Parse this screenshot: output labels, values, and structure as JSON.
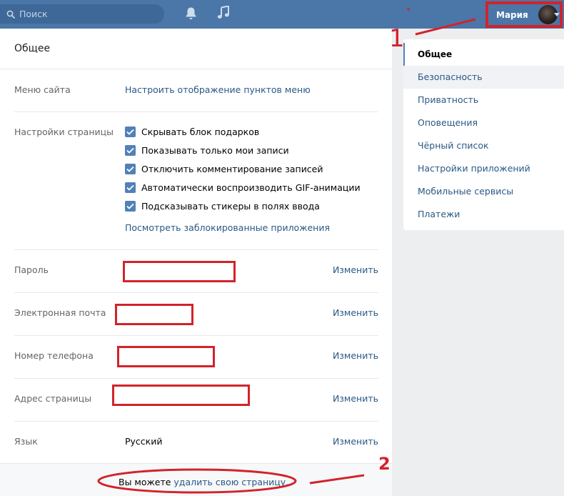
{
  "topbar": {
    "search_placeholder": "Поиск",
    "profile_name": "Мария"
  },
  "main": {
    "title": "Общее",
    "menu_label": "Меню сайта",
    "menu_link": "Настроить отображение пунктов меню",
    "page_settings_label": "Настройки страницы",
    "checkboxes": [
      {
        "label": "Скрывать блок подарков",
        "checked": true
      },
      {
        "label": "Показывать только мои записи",
        "checked": true
      },
      {
        "label": "Отключить комментирование записей",
        "checked": true
      },
      {
        "label": "Автоматически воспроизводить GIF-анимации",
        "checked": true
      },
      {
        "label": "Подсказывать стикеры в полях ввода",
        "checked": true
      }
    ],
    "blocked_apps_link": "Посмотреть заблокированные приложения",
    "rows": [
      {
        "label": "Пароль",
        "value": "",
        "action": "Изменить"
      },
      {
        "label": "Электронная почта",
        "value": "",
        "action": "Изменить"
      },
      {
        "label": "Номер телефона",
        "value": "",
        "action": "Изменить"
      },
      {
        "label": "Адрес страницы",
        "value": "",
        "action": "Изменить"
      },
      {
        "label": "Язык",
        "value": "Русский",
        "action": "Изменить"
      }
    ],
    "footer_prefix": "Вы можете",
    "footer_link": "удалить свою страницу."
  },
  "sidebar": {
    "items": [
      {
        "label": "Общее",
        "active": true
      },
      {
        "label": "Безопасность"
      },
      {
        "label": "Приватность"
      },
      {
        "label": "Оповещения"
      },
      {
        "label": "Чёрный список"
      },
      {
        "label": "Настройки приложений"
      },
      {
        "label": "Мобильные сервисы"
      },
      {
        "label": "Платежи"
      }
    ]
  },
  "annotations": {
    "marker_1": "1",
    "marker_2": "2"
  },
  "colors": {
    "header": "#4a76a8",
    "link": "#2a5885",
    "checkbox": "#5181b8",
    "annotation": "#d2232a"
  }
}
